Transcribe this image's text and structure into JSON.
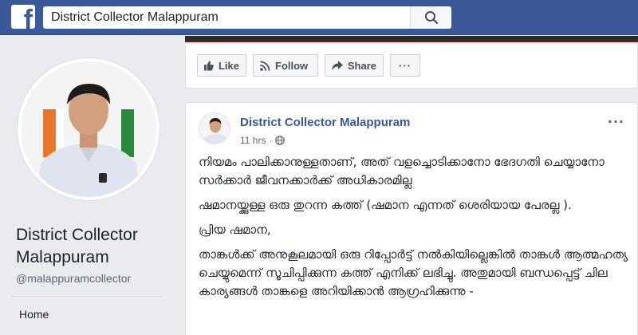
{
  "header": {
    "logo_letter": "f",
    "search_value": "District Collector Malappuram",
    "brand_color": "#3b5998"
  },
  "page": {
    "name": "District Collector Malappuram",
    "handle": "@malappuramcollector",
    "nav": [
      "Home"
    ]
  },
  "actions": {
    "like": "Like",
    "follow": "Follow",
    "share": "Share",
    "more": "···"
  },
  "post": {
    "author": "District Collector Malappuram",
    "time": "11 hrs",
    "separator": "·",
    "options": "···",
    "paragraphs": [
      "നിയമം പാലിക്കാനുള്ളതാണ്, അത് വളച്ചൊടിക്കാനോ ഭേദഗതി ചെയ്യാനോ സർക്കാർ ജീവനക്കാർക്ക് അധികാരമില്ല",
      "ഷമാനയ്ക്കുള്ള ഒരു തുറന്ന കത്ത് (ഷമാന എന്നത് ശെരിയായ പേരല്ല ).",
      "പ്രിയ ഷമാന,",
      "താങ്കൾക്ക് അനുകൂലമായി ഒരു റിപ്പോർട്ട് നൽകിയില്ലെങ്കിൽ താങ്കൾ ആത്മഹത്യ ചെയ്യുമെന്ന് സൂചിപ്പിക്കുന്ന കത്ത് എനിക്ക് ലഭിച്ചു. അതുമായി ബന്ധപ്പെട്ട് ചില കാര്യങ്ങൾ താങ്കളെ അറിയിക്കാൻ ആഗ്രഹിക്കുന്നു -"
    ]
  }
}
